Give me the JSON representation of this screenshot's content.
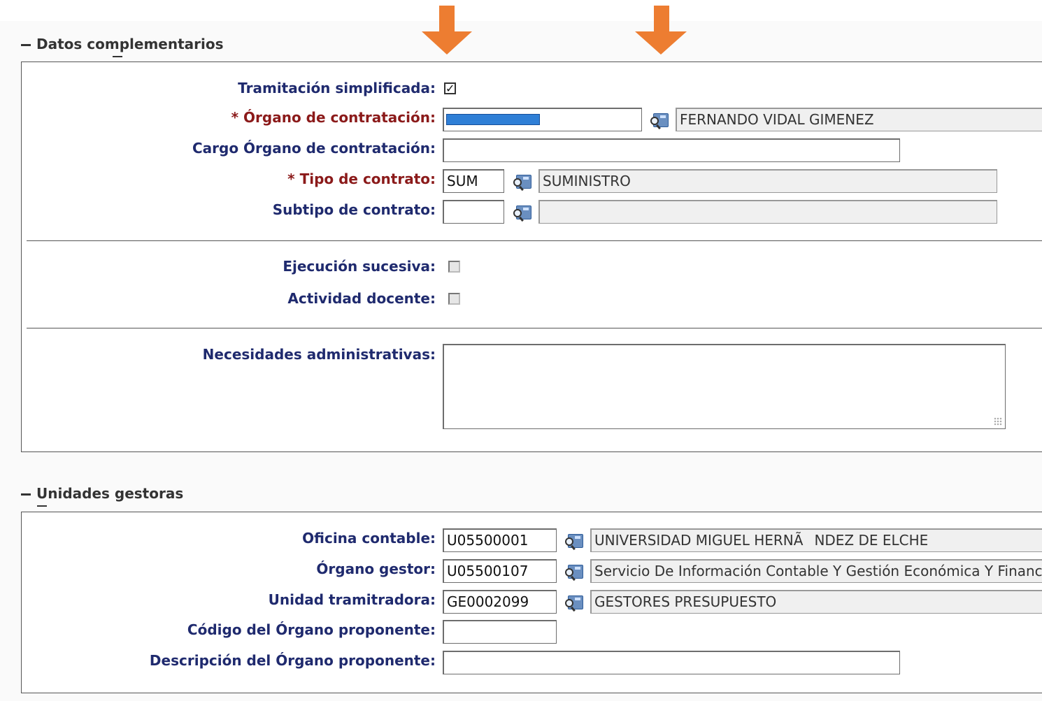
{
  "datos": {
    "title": "Datos complementarios",
    "tramitacion_label": "Tramitación simplificada:",
    "tramitacion_checked": true,
    "organo_label": "* Órgano de contratación:",
    "organo_desc": "FERNANDO VIDAL GIMENEZ",
    "cargo_label": "Cargo Órgano de contratación:",
    "cargo_value": "",
    "tipo_label": "* Tipo de contrato:",
    "tipo_code": "SUM",
    "tipo_desc": "SUMINISTRO",
    "subtipo_label": "Subtipo de contrato:",
    "subtipo_code": "",
    "subtipo_desc": "",
    "ejecucion_label": "Ejecución sucesiva:",
    "ejecucion_checked": false,
    "actividad_label": "Actividad docente:",
    "actividad_checked": false,
    "necesidades_label": "Necesidades administrativas:",
    "necesidades_value": ""
  },
  "unidades": {
    "title": "Unidades gestoras",
    "oficina_label": "Oficina contable:",
    "oficina_code": "U05500001",
    "oficina_desc": "UNIVERSIDAD MIGUEL HERNÃNDEZ DE ELCHE",
    "organo_gestor_label": "Órgano gestor:",
    "organo_gestor_code": "U05500107",
    "organo_gestor_desc": "Servicio De Información Contable Y Gestión Económica Y Financie",
    "unidad_label": "Unidad tramitradora:",
    "unidad_code": "GE0002099",
    "unidad_desc": "GESTORES PRESUPUESTO",
    "codigo_prop_label": "Código del Órgano proponente:",
    "codigo_prop_value": "",
    "desc_prop_label": "Descripción del Órgano proponente:",
    "desc_prop_value": ""
  },
  "colors": {
    "label": "#1f2a6e",
    "required_label": "#8b1a1a",
    "arrow": "#ed7d31",
    "redaction": "#2f7fd6"
  },
  "icons": {
    "lookup": "lookup-magnifier-icon",
    "collapse": "collapse-minus-icon",
    "annotation": "down-arrow-icon"
  }
}
